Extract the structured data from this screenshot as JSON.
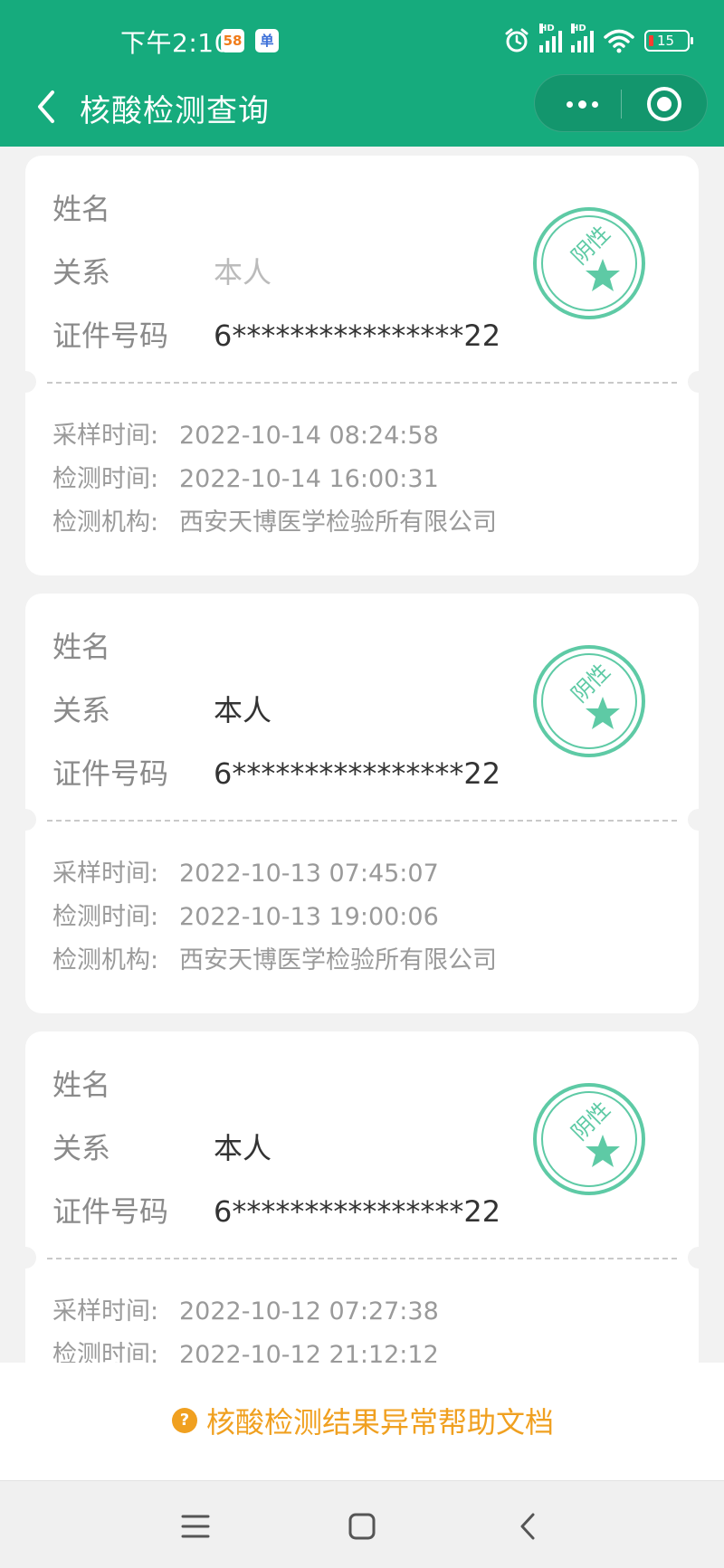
{
  "status_bar": {
    "time": "下午2:10",
    "badge_58": "58",
    "badge_app": "单",
    "battery": "15",
    "hd": "HD"
  },
  "header": {
    "title": "核酸检测查询"
  },
  "labels": {
    "name": "姓名",
    "relation": "关系",
    "id_number": "证件号码",
    "sample_time": "采样时间:",
    "test_time": "检测时间:",
    "institution": "检测机构:"
  },
  "stamp_text": "阴性",
  "colors": {
    "brand": "#16ab7d",
    "stamp": "#5ecaa5",
    "help": "#f0a020"
  },
  "records": [
    {
      "relation": "本人",
      "id_number": "6****************22",
      "sample_time": "2022-10-14 08:24:58",
      "test_time": "2022-10-14 16:00:31",
      "institution": "西安天博医学检验所有限公司"
    },
    {
      "relation": "本人",
      "id_number": "6****************22",
      "sample_time": "2022-10-13 07:45:07",
      "test_time": "2022-10-13 19:00:06",
      "institution": "西安天博医学检验所有限公司"
    },
    {
      "relation": "本人",
      "id_number": "6****************22",
      "sample_time": "2022-10-12 07:27:38",
      "test_time": "2022-10-12 21:12:12",
      "institution": ""
    }
  ],
  "help": {
    "label": "核酸检测结果异常帮助文档",
    "icon": "question-icon",
    "icon_char": "?"
  }
}
